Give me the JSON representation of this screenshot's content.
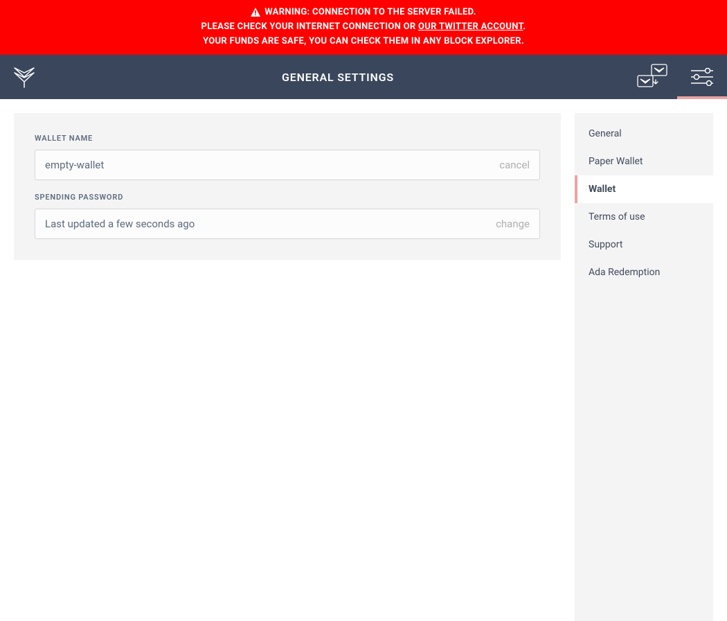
{
  "warning": {
    "line1": "WARNING: CONNECTION TO THE SERVER FAILED.",
    "line2_prefix": "PLEASE CHECK YOUR INTERNET CONNECTION OR ",
    "line2_link": "OUR TWITTER ACCOUNT",
    "line2_suffix": ".",
    "line3": "YOUR FUNDS ARE SAFE, YOU CAN CHECK THEM IN ANY BLOCK EXPLORER."
  },
  "header": {
    "title": "GENERAL SETTINGS"
  },
  "settings": {
    "wallet_name": {
      "label": "WALLET NAME",
      "value": "empty-wallet",
      "action": "cancel"
    },
    "spending_password": {
      "label": "SPENDING PASSWORD",
      "status": "Last updated a few seconds ago",
      "action": "change"
    }
  },
  "sidebar": {
    "items": [
      {
        "label": "General",
        "active": false
      },
      {
        "label": "Paper Wallet",
        "active": false
      },
      {
        "label": "Wallet",
        "active": true
      },
      {
        "label": "Terms of use",
        "active": false
      },
      {
        "label": "Support",
        "active": false
      },
      {
        "label": "Ada Redemption",
        "active": false
      }
    ]
  }
}
